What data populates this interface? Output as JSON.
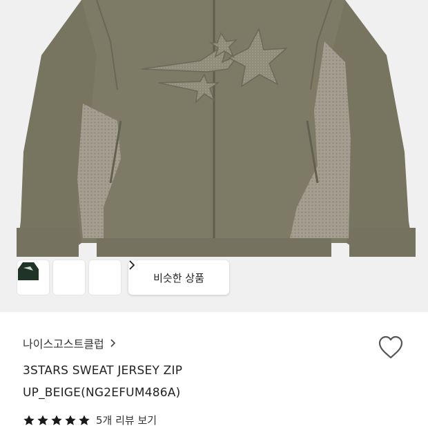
{
  "colors": {
    "page_background": "#ffffff",
    "hero_background": "#f0f0f0",
    "jacket_olive": "#7d7b66",
    "mesh_panel": "#a8a394",
    "heart_outline": "#555555",
    "star_fill": "#1a1a1a"
  },
  "gallery": {
    "color_options": [
      {
        "name": "black-variant",
        "color": "#2b2a2b"
      },
      {
        "name": "light-gray-variant",
        "color": "#d4d2cd"
      },
      {
        "name": "dark-green-variant",
        "color": "#1f3327"
      }
    ],
    "similar_products_label": "비슷한 상품",
    "similar_products_icon": "chevron-right-icon"
  },
  "product": {
    "brand": "나이스고스트클럽",
    "brand_icon": "chevron-right-icon",
    "title": "3STARS SWEAT JERSEY ZIP UP_BEIGE(NG2EFUM486A)",
    "wishlist_icon": "heart-icon"
  },
  "rating": {
    "stars": 5,
    "max_stars": 5,
    "review_label": "5개 리뷰 보기"
  }
}
